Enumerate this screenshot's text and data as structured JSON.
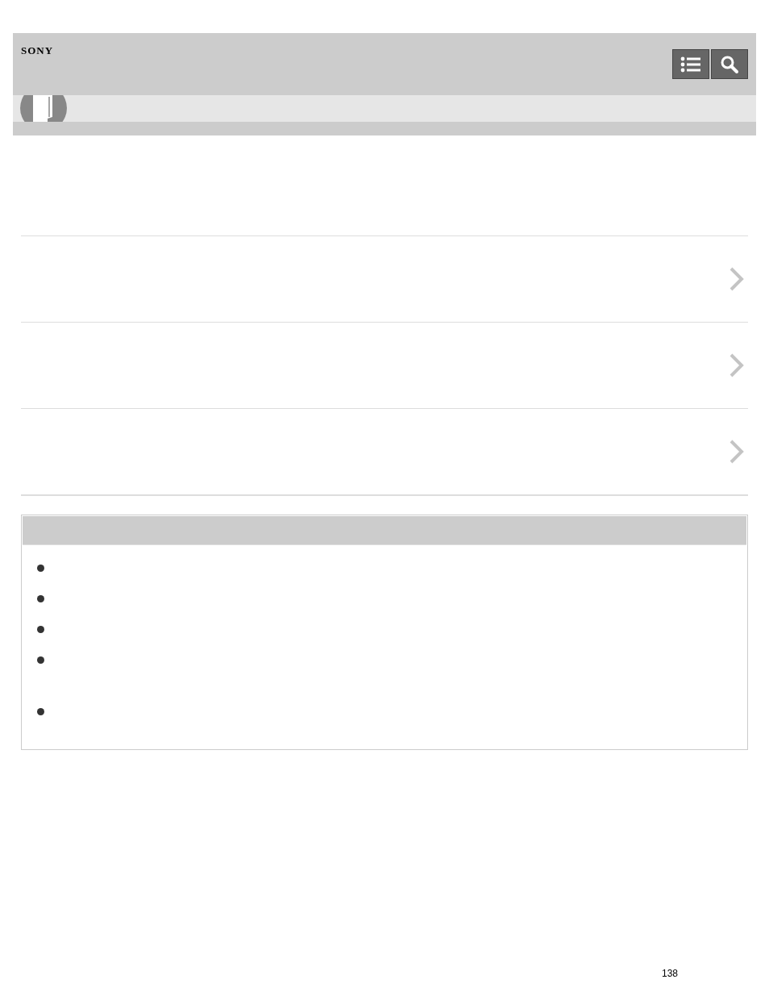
{
  "header": {
    "logo": "SONY"
  },
  "links": [
    {
      "kind": "link"
    },
    {
      "kind": "link"
    },
    {
      "kind": "link"
    }
  ],
  "notes": {
    "items": [
      {
        "kind": "single"
      },
      {
        "kind": "single"
      },
      {
        "kind": "single"
      },
      {
        "kind": "double"
      },
      {
        "kind": "single"
      }
    ]
  },
  "page_number": "138"
}
